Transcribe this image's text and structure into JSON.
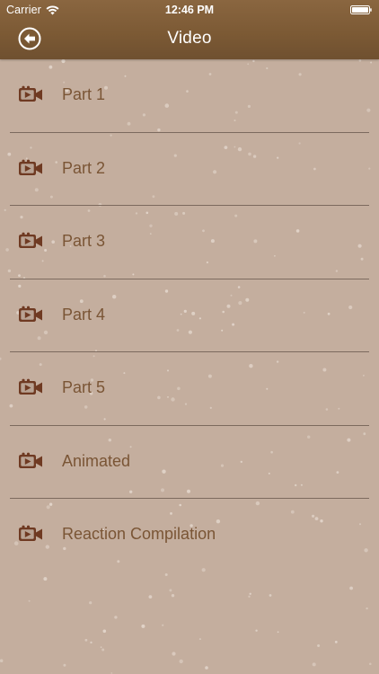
{
  "status_bar": {
    "carrier": "Carrier",
    "time": "12:46 PM",
    "wifi_icon": "wifi-icon",
    "battery_icon": "battery-icon"
  },
  "nav": {
    "title": "Video",
    "back_icon": "back-arrow-icon"
  },
  "list": {
    "item_icon": "video-camera-icon",
    "items": [
      {
        "label": "Part 1"
      },
      {
        "label": "Part 2"
      },
      {
        "label": "Part 3"
      },
      {
        "label": "Part 4"
      },
      {
        "label": "Part 5"
      },
      {
        "label": "Animated"
      },
      {
        "label": "Reaction Compilation"
      }
    ]
  },
  "colors": {
    "header": "#7b5934",
    "background": "#c4ae9e",
    "label_text": "#7a5535",
    "icon": "#6f3a22",
    "separator": "#7c6a5e"
  }
}
